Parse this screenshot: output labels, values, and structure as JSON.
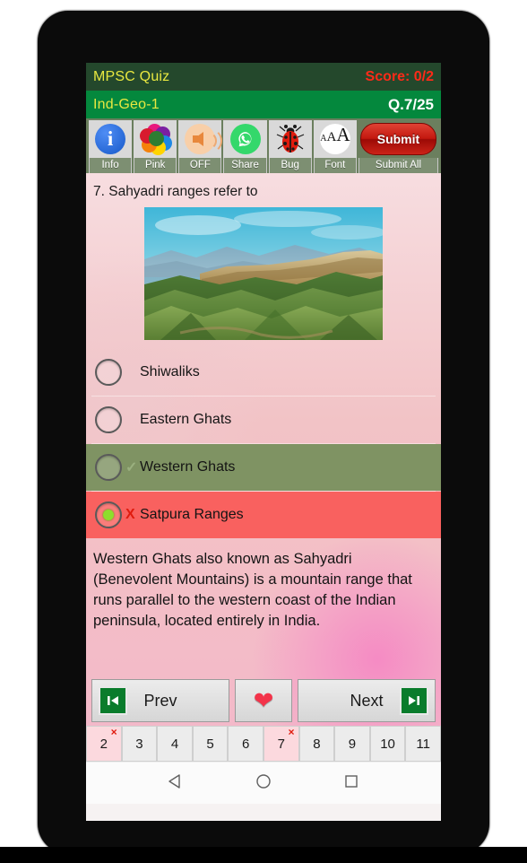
{
  "app": {
    "title": "MPSC Quiz",
    "score_label": "Score: 0/2",
    "quiz_name": "Ind-Geo-1",
    "question_counter": "Q.7/25"
  },
  "toolbar": {
    "items": [
      {
        "label": "Info",
        "icon": "info-icon"
      },
      {
        "label": "Pink",
        "icon": "color-palette-icon"
      },
      {
        "label": "OFF",
        "icon": "speaker-icon"
      },
      {
        "label": "Share",
        "icon": "whatsapp-icon"
      },
      {
        "label": "Bug",
        "icon": "bug-icon"
      },
      {
        "label": "Font",
        "icon": "font-size-icon"
      }
    ],
    "submit_label": "Submit",
    "submit_all_label": "Submit All"
  },
  "question": {
    "text": "7. Sahyadri ranges refer to",
    "image_alt": "western-ghats-mountain-range-photo",
    "options": [
      {
        "label": "Shiwaliks",
        "selected": false,
        "state": "neutral",
        "mark": ""
      },
      {
        "label": "Eastern Ghats",
        "selected": false,
        "state": "neutral",
        "mark": ""
      },
      {
        "label": "Western Ghats",
        "selected": false,
        "state": "correct",
        "mark": "✓"
      },
      {
        "label": "Satpura Ranges",
        "selected": true,
        "state": "wrong",
        "mark": "X"
      }
    ],
    "explanation": "Western Ghats also known as Sahyadri (Benevolent Mountains) is a mountain range that runs parallel to the western coast of the Indian peninsula, located entirely in India."
  },
  "navigation": {
    "prev_label": "Prev",
    "next_label": "Next",
    "favorite_icon": "heart-icon"
  },
  "pagination": {
    "pages": [
      {
        "number": "2",
        "wrong": true
      },
      {
        "number": "3",
        "wrong": false
      },
      {
        "number": "4",
        "wrong": false
      },
      {
        "number": "5",
        "wrong": false
      },
      {
        "number": "6",
        "wrong": false
      },
      {
        "number": "7",
        "wrong": true
      },
      {
        "number": "8",
        "wrong": false
      },
      {
        "number": "9",
        "wrong": false
      },
      {
        "number": "10",
        "wrong": false
      },
      {
        "number": "11",
        "wrong": false
      }
    ],
    "wrong_mark": "×"
  },
  "android_nav": {
    "back": "back-triangle-icon",
    "home": "home-circle-icon",
    "recents": "recents-square-icon"
  },
  "colors": {
    "app_bar": "#24482c",
    "quiz_bar": "#04883d",
    "title_text": "#e8e840",
    "score_text": "#ff2a18",
    "correct_row": "#7f9363",
    "wrong_row": "#f9615f",
    "submit_red": "#c3180f",
    "selected_radio": "#8ede2c"
  }
}
